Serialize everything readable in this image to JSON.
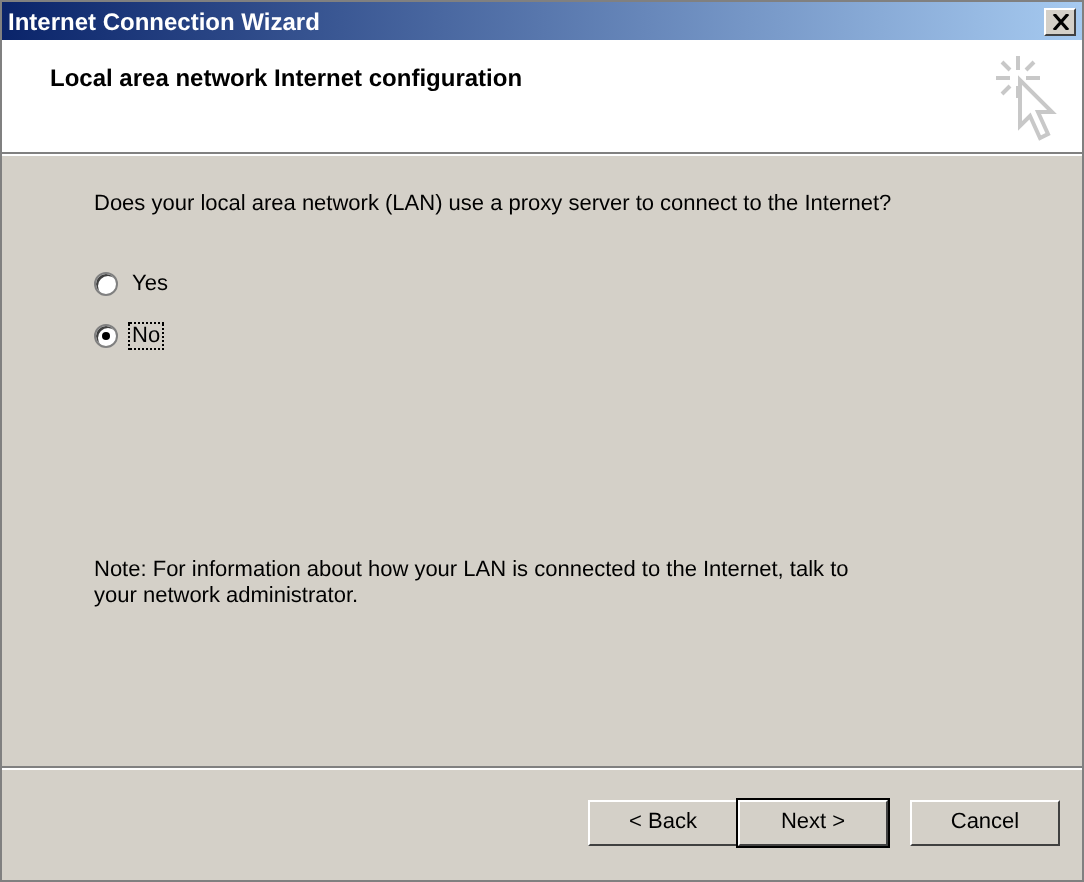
{
  "window": {
    "title": "Internet Connection Wizard"
  },
  "header": {
    "title": "Local area network Internet configuration"
  },
  "question": "Does your local area network (LAN) use a proxy server to connect to the Internet?",
  "options": [
    {
      "label": "Yes",
      "selected": false
    },
    {
      "label": "No",
      "selected": true
    }
  ],
  "note": "Note: For information about how your LAN is connected to the Internet, talk to your network administrator.",
  "buttons": [
    {
      "label": "< Back",
      "default": false
    },
    {
      "label": "Next >",
      "default": true
    },
    {
      "label": "Cancel",
      "default": false
    }
  ]
}
